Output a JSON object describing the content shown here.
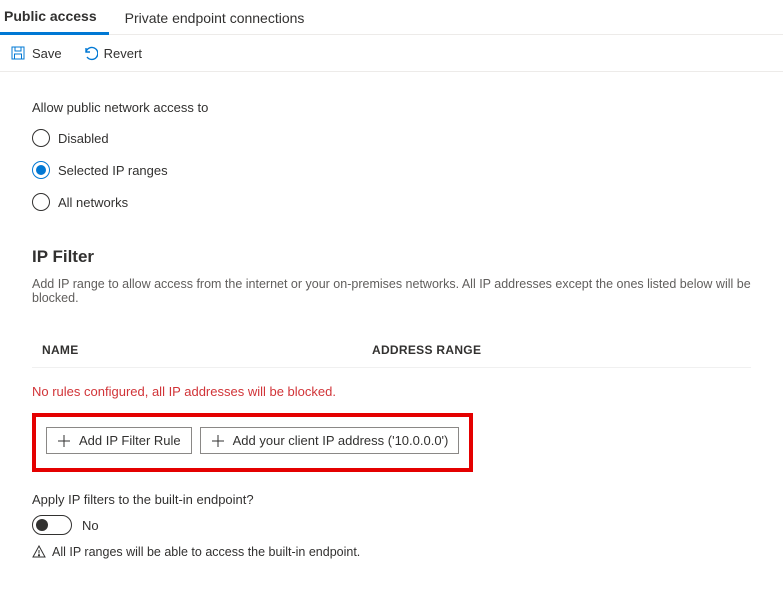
{
  "tabs": {
    "public_access": "Public access",
    "private_endpoint": "Private endpoint connections"
  },
  "toolbar": {
    "save_label": "Save",
    "revert_label": "Revert"
  },
  "publicAccess": {
    "section_label": "Allow public network access to",
    "options": {
      "disabled": "Disabled",
      "selected_ip": "Selected IP ranges",
      "all_networks": "All networks"
    }
  },
  "ipFilter": {
    "heading": "IP Filter",
    "description": "Add IP range to allow access from the internet or your on-premises networks. All IP addresses except the ones listed below will be blocked.",
    "columns": {
      "name": "NAME",
      "range": "ADDRESS RANGE"
    },
    "empty_message": "No rules configured, all IP addresses will be blocked.",
    "add_rule_label": "Add IP Filter Rule",
    "add_client_ip_label": "Add your client IP address ('10.0.0.0')"
  },
  "applyFilters": {
    "label": "Apply IP filters to the built-in endpoint?",
    "toggle_value": "No",
    "info": "All IP ranges will be able to access the built-in endpoint."
  }
}
